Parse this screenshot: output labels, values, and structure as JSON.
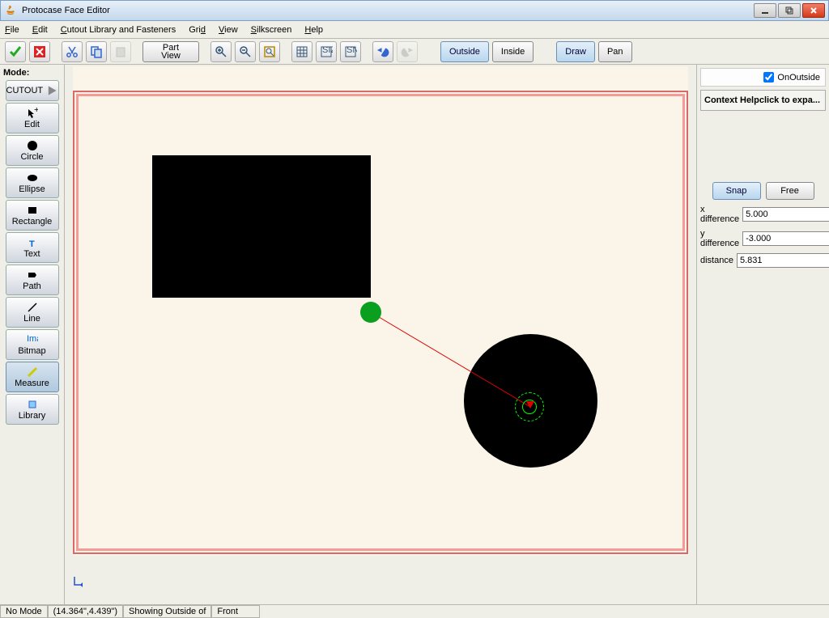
{
  "title": "Protocase Face Editor",
  "menu": {
    "file": "File",
    "edit": "Edit",
    "cutout": "Cutout Library and Fasteners",
    "grid": "Grid",
    "view": "View",
    "silk": "Silkscreen",
    "help": "Help"
  },
  "toolbar": {
    "part_view": "Part View",
    "outside": "Outside",
    "inside": "Inside",
    "draw": "Draw",
    "pan": "Pan"
  },
  "mode_label": "Mode:",
  "tools": {
    "cutout": "CUTOUT",
    "edit": "Edit",
    "circle": "Circle",
    "ellipse": "Ellipse",
    "rect": "Rectangle",
    "text": "Text",
    "path": "Path",
    "line": "Line",
    "bitmap": "Bitmap",
    "measure": "Measure",
    "library": "Library"
  },
  "right": {
    "onoutside": "OnOutside",
    "context_help": "Context Helpclick to expa...",
    "snap": "Snap",
    "free": "Free",
    "xlabel": "x difference",
    "ylabel": "y difference",
    "dlabel": "distance",
    "xval": "5.000",
    "yval": "-3.000",
    "dval": "5.831"
  },
  "status": {
    "mode": "No Mode",
    "coords": "(14.364\",4.439\")",
    "showing": "Showing Outside of",
    "face": "Front"
  }
}
